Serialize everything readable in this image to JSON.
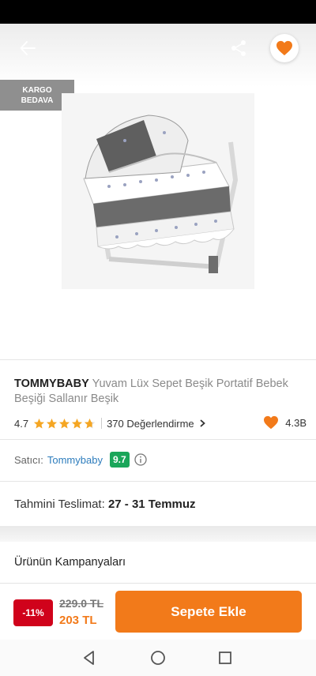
{
  "header": {
    "back_icon": "arrow-left-icon",
    "share_icon": "share-icon",
    "favorite_icon": "heart-icon"
  },
  "badge": {
    "line1": "KARGO",
    "line2": "BEDAVA"
  },
  "product": {
    "brand": "TOMMYBABY",
    "name": "Yuvam Lüx Sepet Beşik Portatif Bebek Beşiği Sallanır Beşik",
    "image_icon": "baby-cradle-image"
  },
  "rating": {
    "value": "4.7",
    "stars": 4.7,
    "reviews": "370 Değerlendirme",
    "favorites": "4.3B"
  },
  "seller": {
    "label": "Satıcı:",
    "name": "Tommybaby",
    "score": "9.7"
  },
  "delivery": {
    "label": "Tahmini Teslimat:",
    "dates": "27 - 31 Temmuz"
  },
  "campaigns": {
    "title": "Ürünün Kampanyaları"
  },
  "purchase": {
    "discount": "-11%",
    "old_price": "229.0 TL",
    "new_price": "203 TL",
    "cart_label": "Sepete Ekle"
  },
  "colors": {
    "accent": "#f27a1a",
    "discount": "#d0021b",
    "seller_score": "#1aa65a",
    "seller_link": "#2e7dbd",
    "star": "#f5a623"
  }
}
